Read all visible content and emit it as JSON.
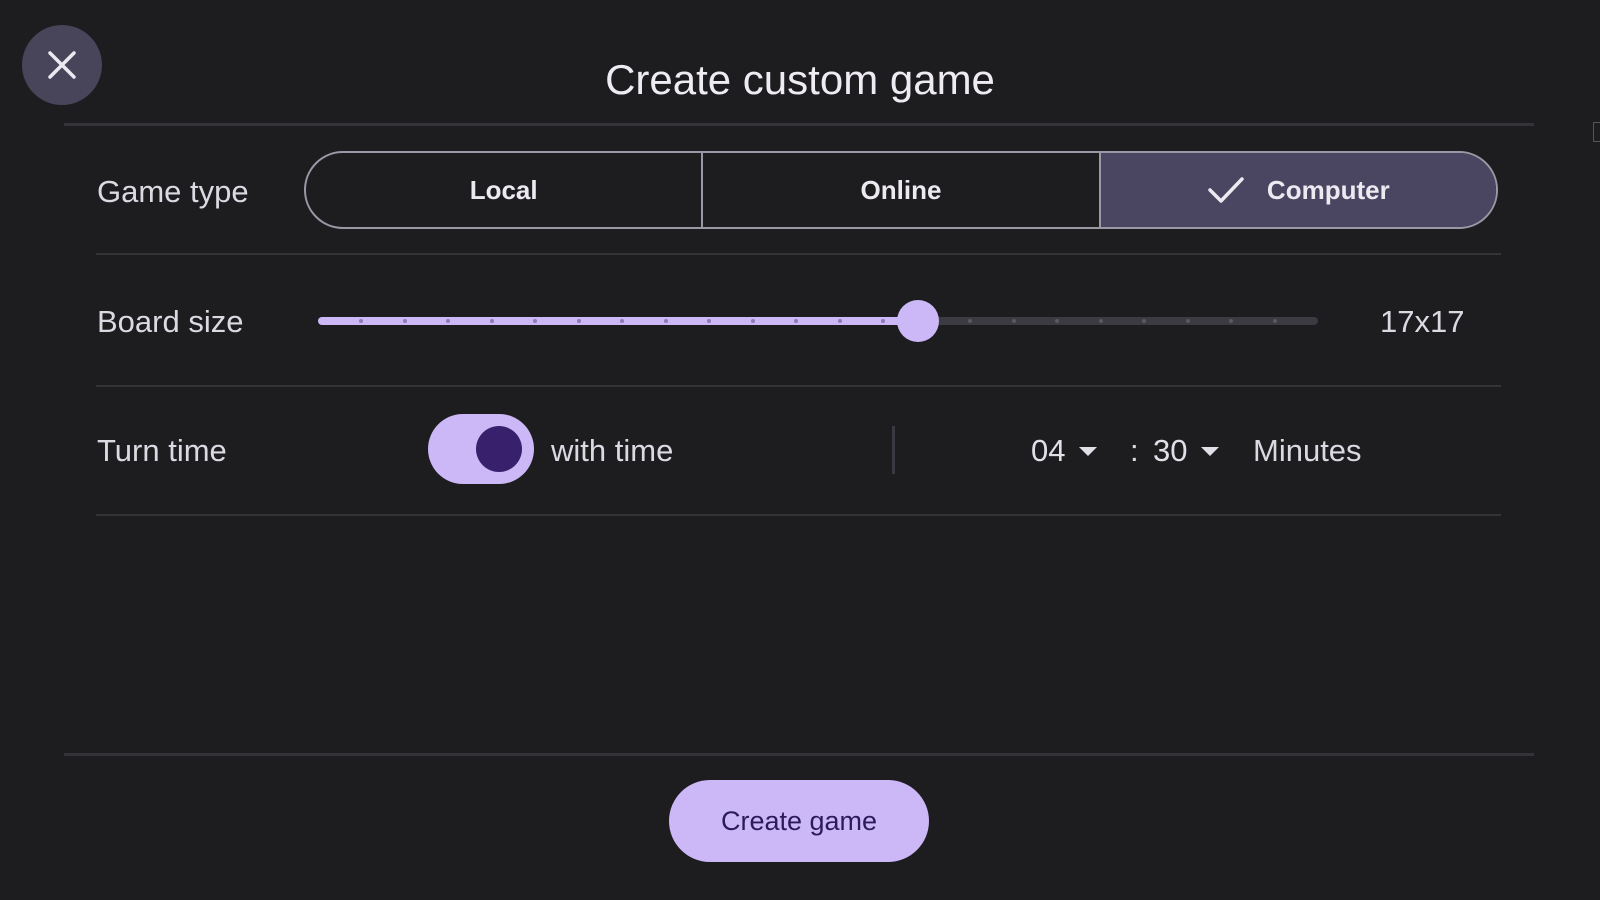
{
  "dialog": {
    "title": "Create custom game",
    "close_icon": "close-icon"
  },
  "game_type": {
    "label": "Game type",
    "options": [
      {
        "label": "Local",
        "selected": false
      },
      {
        "label": "Online",
        "selected": false
      },
      {
        "label": "Computer",
        "selected": true
      }
    ],
    "selected_icon": "check-icon"
  },
  "board_size": {
    "label": "Board size",
    "value": "17x17",
    "slider_fraction": 0.6,
    "tick_count": 22
  },
  "turn_time": {
    "label": "Turn time",
    "toggle_on": true,
    "toggle_label": "with time",
    "minutes": "04",
    "separator": ":",
    "seconds": "30",
    "unit": "Minutes"
  },
  "actions": {
    "create_label": "Create game"
  },
  "colors": {
    "background": "#1d1d20",
    "accent": "#cdb8f7",
    "selected_segment": "#4a4560",
    "toggle_knob": "#38206d"
  }
}
